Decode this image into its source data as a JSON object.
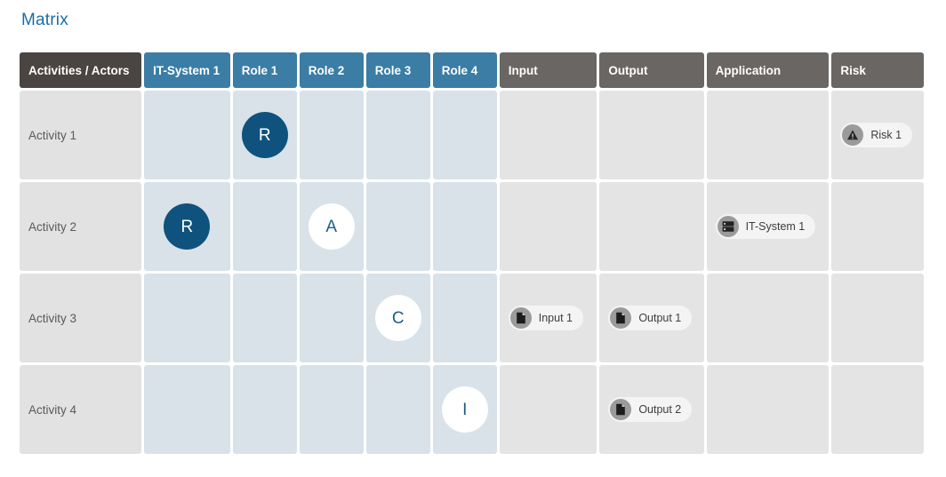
{
  "page": {
    "title": "Matrix"
  },
  "colors": {
    "title": "#1b6ca8",
    "header_corner": "#4a4442",
    "header_actor": "#3b7da5",
    "header_meta": "#6a6664",
    "cell_activity": "#e2e2e2",
    "cell_raci": "#d8e2e8",
    "cell_meta": "#e4e4e4",
    "raci_filled": "#10527e",
    "raci_open_text": "#1d5e86",
    "badge_icon": "#9b9b9b",
    "badge_bg": "#f4f4f4"
  },
  "table": {
    "columns": [
      {
        "key": "activity",
        "label": "Activities / Actors",
        "type": "corner"
      },
      {
        "key": "itsystem1",
        "label": "IT-System 1",
        "type": "actor"
      },
      {
        "key": "role1",
        "label": "Role 1",
        "type": "actor"
      },
      {
        "key": "role2",
        "label": "Role 2",
        "type": "actor"
      },
      {
        "key": "role3",
        "label": "Role 3",
        "type": "actor"
      },
      {
        "key": "role4",
        "label": "Role 4",
        "type": "actor"
      },
      {
        "key": "input",
        "label": "Input",
        "type": "meta"
      },
      {
        "key": "output",
        "label": "Output",
        "type": "meta"
      },
      {
        "key": "application",
        "label": "Application",
        "type": "meta"
      },
      {
        "key": "risk",
        "label": "Risk",
        "type": "meta"
      }
    ],
    "rows": [
      {
        "label": "Activity 1",
        "cells": [
          {
            "col": "itsystem1",
            "kind": "raci",
            "value": ""
          },
          {
            "col": "role1",
            "kind": "raci",
            "value": "R",
            "style": "filled"
          },
          {
            "col": "role2",
            "kind": "raci",
            "value": ""
          },
          {
            "col": "role3",
            "kind": "raci",
            "value": ""
          },
          {
            "col": "role4",
            "kind": "raci",
            "value": ""
          },
          {
            "col": "input",
            "kind": "meta",
            "badges": []
          },
          {
            "col": "output",
            "kind": "meta",
            "badges": []
          },
          {
            "col": "application",
            "kind": "meta",
            "badges": []
          },
          {
            "col": "risk",
            "kind": "meta",
            "badges": [
              {
                "label": "Risk 1",
                "icon": "warning-triangle-icon"
              }
            ]
          }
        ]
      },
      {
        "label": "Activity 2",
        "cells": [
          {
            "col": "itsystem1",
            "kind": "raci",
            "value": "R",
            "style": "filled"
          },
          {
            "col": "role1",
            "kind": "raci",
            "value": ""
          },
          {
            "col": "role2",
            "kind": "raci",
            "value": "A",
            "style": "open"
          },
          {
            "col": "role3",
            "kind": "raci",
            "value": ""
          },
          {
            "col": "role4",
            "kind": "raci",
            "value": ""
          },
          {
            "col": "input",
            "kind": "meta",
            "badges": []
          },
          {
            "col": "output",
            "kind": "meta",
            "badges": []
          },
          {
            "col": "application",
            "kind": "meta",
            "badges": [
              {
                "label": "IT-System 1",
                "icon": "server-icon"
              }
            ]
          },
          {
            "col": "risk",
            "kind": "meta",
            "badges": []
          }
        ]
      },
      {
        "label": "Activity 3",
        "cells": [
          {
            "col": "itsystem1",
            "kind": "raci",
            "value": ""
          },
          {
            "col": "role1",
            "kind": "raci",
            "value": ""
          },
          {
            "col": "role2",
            "kind": "raci",
            "value": ""
          },
          {
            "col": "role3",
            "kind": "raci",
            "value": "C",
            "style": "open"
          },
          {
            "col": "role4",
            "kind": "raci",
            "value": ""
          },
          {
            "col": "input",
            "kind": "meta",
            "badges": [
              {
                "label": "Input 1",
                "icon": "document-icon"
              }
            ]
          },
          {
            "col": "output",
            "kind": "meta",
            "badges": [
              {
                "label": "Output 1",
                "icon": "document-icon"
              }
            ]
          },
          {
            "col": "application",
            "kind": "meta",
            "badges": []
          },
          {
            "col": "risk",
            "kind": "meta",
            "badges": []
          }
        ]
      },
      {
        "label": "Activity 4",
        "cells": [
          {
            "col": "itsystem1",
            "kind": "raci",
            "value": ""
          },
          {
            "col": "role1",
            "kind": "raci",
            "value": ""
          },
          {
            "col": "role2",
            "kind": "raci",
            "value": ""
          },
          {
            "col": "role3",
            "kind": "raci",
            "value": ""
          },
          {
            "col": "role4",
            "kind": "raci",
            "value": "I",
            "style": "open"
          },
          {
            "col": "input",
            "kind": "meta",
            "badges": []
          },
          {
            "col": "output",
            "kind": "meta",
            "badges": [
              {
                "label": "Output 2",
                "icon": "document-icon"
              }
            ]
          },
          {
            "col": "application",
            "kind": "meta",
            "badges": []
          },
          {
            "col": "risk",
            "kind": "meta",
            "badges": []
          }
        ]
      }
    ]
  }
}
